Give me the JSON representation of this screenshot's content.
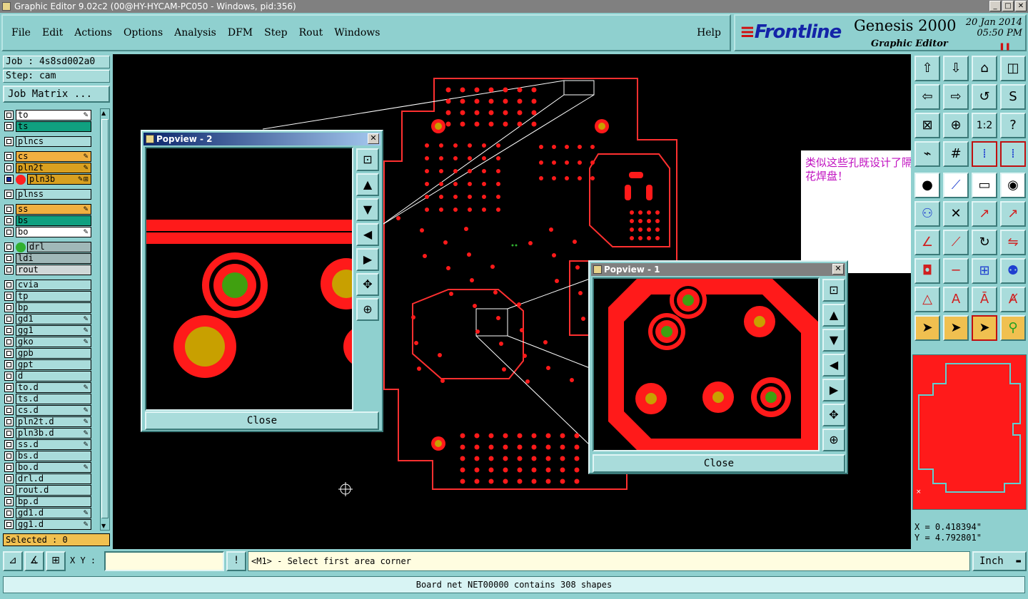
{
  "window": {
    "title": "Graphic Editor 9.02c2 (00@HY-HYCAM-PC050 - Windows, pid:356)"
  },
  "menu": {
    "file": "File",
    "edit": "Edit",
    "actions": "Actions",
    "options": "Options",
    "analysis": "Analysis",
    "dfm": "DFM",
    "step": "Step",
    "rout": "Rout",
    "windows": "Windows",
    "help": "Help"
  },
  "brand": {
    "logo": "Frontline",
    "product": "Genesis 2000",
    "subtitle": "Graphic Editor",
    "date": "20 Jan 2014",
    "time": "05:50 PM"
  },
  "job": {
    "job_line": "Job : 4s8sd002a0",
    "step_line": "Step: cam",
    "matrix_button": "Job Matrix ..."
  },
  "layers": [
    {
      "name": "to",
      "bg": "#ffffff",
      "flag": "✎",
      "dot": ""
    },
    {
      "name": "ts",
      "bg": "#10a080",
      "flag": "",
      "dot": ""
    },
    {
      "name": "plncs",
      "bg": "#a9dcdb",
      "flag": "",
      "dot": "",
      "gap": true
    },
    {
      "name": "cs",
      "bg": "#f0b040",
      "flag": "✎",
      "dot": "",
      "gap": true
    },
    {
      "name": "pln2t",
      "bg": "#d8a020",
      "flag": "✎",
      "dot": ""
    },
    {
      "name": "pln3b",
      "bg": "#d8a020",
      "flag": "✎⊞",
      "dot": "#ff2020",
      "active": true
    },
    {
      "name": "plnss",
      "bg": "#a9dcdb",
      "flag": "",
      "dot": "",
      "gap": true
    },
    {
      "name": "ss",
      "bg": "#f0b040",
      "flag": "✎",
      "dot": "",
      "gap": true
    },
    {
      "name": "bs",
      "bg": "#10a080",
      "flag": "",
      "dot": ""
    },
    {
      "name": "bo",
      "bg": "#ffffff",
      "flag": "✎",
      "dot": ""
    },
    {
      "name": "drl",
      "bg": "#a0b8b8",
      "flag": "",
      "dot": "#30b030",
      "gap": true
    },
    {
      "name": "ldi",
      "bg": "#a0b8b8",
      "flag": "",
      "dot": ""
    },
    {
      "name": "rout",
      "bg": "#d0d8d8",
      "flag": "",
      "dot": ""
    },
    {
      "name": "cvia",
      "bg": "#a9dcdb",
      "flag": "",
      "dot": "",
      "gap": true
    },
    {
      "name": "tp",
      "bg": "#a9dcdb",
      "flag": "",
      "dot": ""
    },
    {
      "name": "bp",
      "bg": "#a9dcdb",
      "flag": "",
      "dot": ""
    },
    {
      "name": "gd1",
      "bg": "#a9dcdb",
      "flag": "✎",
      "dot": ""
    },
    {
      "name": "gg1",
      "bg": "#a9dcdb",
      "flag": "✎",
      "dot": ""
    },
    {
      "name": "gko",
      "bg": "#a9dcdb",
      "flag": "✎",
      "dot": ""
    },
    {
      "name": "gpb",
      "bg": "#a9dcdb",
      "flag": "",
      "dot": ""
    },
    {
      "name": "gpt",
      "bg": "#a9dcdb",
      "flag": "",
      "dot": ""
    },
    {
      "name": "d",
      "bg": "#a9dcdb",
      "flag": "",
      "dot": ""
    },
    {
      "name": "to.d",
      "bg": "#a9dcdb",
      "flag": "✎",
      "dot": ""
    },
    {
      "name": "ts.d",
      "bg": "#a9dcdb",
      "flag": "",
      "dot": ""
    },
    {
      "name": "cs.d",
      "bg": "#a9dcdb",
      "flag": "✎",
      "dot": ""
    },
    {
      "name": "pln2t.d",
      "bg": "#a9dcdb",
      "flag": "✎",
      "dot": ""
    },
    {
      "name": "pln3b.d",
      "bg": "#a9dcdb",
      "flag": "✎",
      "dot": ""
    },
    {
      "name": "ss.d",
      "bg": "#a9dcdb",
      "flag": "✎",
      "dot": ""
    },
    {
      "name": "bs.d",
      "bg": "#a9dcdb",
      "flag": "",
      "dot": ""
    },
    {
      "name": "bo.d",
      "bg": "#a9dcdb",
      "flag": "✎",
      "dot": ""
    },
    {
      "name": "drl.d",
      "bg": "#a9dcdb",
      "flag": "",
      "dot": ""
    },
    {
      "name": "rout.d",
      "bg": "#a9dcdb",
      "flag": "",
      "dot": ""
    },
    {
      "name": "bp.d",
      "bg": "#a9dcdb",
      "flag": "",
      "dot": ""
    },
    {
      "name": "gd1.d",
      "bg": "#a9dcdb",
      "flag": "✎",
      "dot": ""
    },
    {
      "name": "gg1.d",
      "bg": "#a9dcdb",
      "flag": "✎",
      "dot": ""
    }
  ],
  "selected": "Selected : 0",
  "annotation": "类似这些孔既设计了隔离又设计了花焊盘！",
  "popview2": {
    "title": "Popview - 2",
    "close": "Close"
  },
  "popview1": {
    "title": "Popview - 1",
    "close": "Close"
  },
  "coords": {
    "x": "X = 0.418394\"",
    "y": "Y = 4.792801\""
  },
  "bottom": {
    "xy_label": "X Y :",
    "xy_value": "",
    "prompt": "<M1> - Select first area corner",
    "units": "Inch"
  },
  "status": "Board net NET00000 contains 308 shapes",
  "colors": {
    "pad": "#ff1a1a",
    "drill_center": "#c8a000",
    "plated": "#40a010",
    "board": "#000000",
    "ui": "#8fd0cf"
  }
}
